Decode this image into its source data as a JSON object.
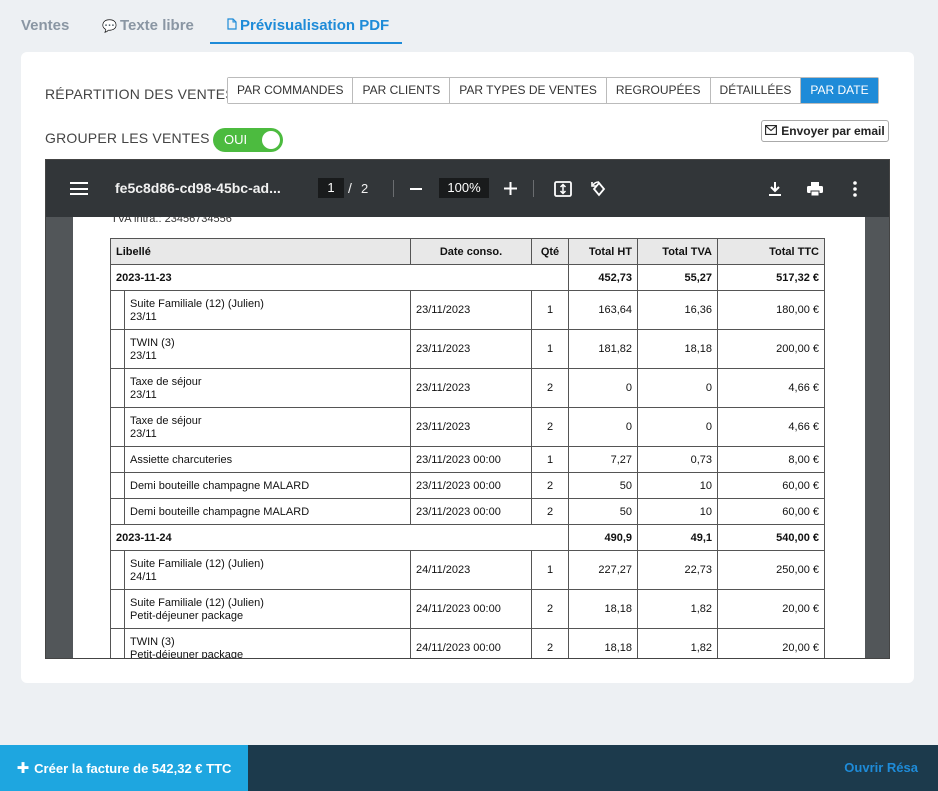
{
  "tabs": [
    {
      "label": "Ventes"
    },
    {
      "label": "Texte libre"
    },
    {
      "label": "Prévisualisation PDF"
    }
  ],
  "repartition": {
    "label": "RÉPARTITION DES VENTES",
    "options": [
      "PAR COMMANDES",
      "PAR CLIENTS",
      "PAR TYPES DE VENTES",
      "REGROUPÉES",
      "DÉTAILLÉES",
      "PAR DATE"
    ],
    "selected": "PAR DATE"
  },
  "grouper": {
    "label": "GROUPER LES VENTES",
    "toggle_label": "OUI",
    "value": true
  },
  "email_button": {
    "label": "Envoyer par email"
  },
  "viewer": {
    "filename": "fe5c8d86-cd98-45bc-ad...",
    "page_current": "1",
    "page_separator": "/",
    "page_total": "2",
    "zoom": "100%",
    "page_top_text": "TVA intra.: 23456734556"
  },
  "table": {
    "headers": [
      "Libellé",
      "Date conso.",
      "Qté",
      "Total HT",
      "Total TVA",
      "Total TTC"
    ],
    "groups": [
      {
        "date": "2023-11-23",
        "total_ht": "452,73",
        "total_tva": "55,27",
        "total_ttc": "517,32 €",
        "items": [
          {
            "label": "Suite Familiale (12) (Julien)",
            "sub": "23/11",
            "date": "23/11/2023",
            "qty": "1",
            "ht": "163,64",
            "tva": "16,36",
            "ttc": "180,00 €"
          },
          {
            "label": "TWIN (3)",
            "sub": "23/11",
            "date": "23/11/2023",
            "qty": "1",
            "ht": "181,82",
            "tva": "18,18",
            "ttc": "200,00 €"
          },
          {
            "label": "Taxe de séjour",
            "sub": "23/11",
            "date": "23/11/2023",
            "qty": "2",
            "ht": "0",
            "tva": "0",
            "ttc": "4,66 €"
          },
          {
            "label": "Taxe de séjour",
            "sub": "23/11",
            "date": "23/11/2023",
            "qty": "2",
            "ht": "0",
            "tva": "0",
            "ttc": "4,66 €"
          },
          {
            "label": "Assiette charcuteries",
            "sub": "",
            "date": "23/11/2023 00:00",
            "qty": "1",
            "ht": "7,27",
            "tva": "0,73",
            "ttc": "8,00 €"
          },
          {
            "label": "Demi bouteille champagne MALARD",
            "sub": "",
            "date": "23/11/2023 00:00",
            "qty": "2",
            "ht": "50",
            "tva": "10",
            "ttc": "60,00 €"
          },
          {
            "label": "Demi bouteille champagne MALARD",
            "sub": "",
            "date": "23/11/2023 00:00",
            "qty": "2",
            "ht": "50",
            "tva": "10",
            "ttc": "60,00 €"
          }
        ]
      },
      {
        "date": "2023-11-24",
        "total_ht": "490,9",
        "total_tva": "49,1",
        "total_ttc": "540,00 €",
        "items": [
          {
            "label": "Suite Familiale (12) (Julien)",
            "sub": "24/11",
            "date": "24/11/2023",
            "qty": "1",
            "ht": "227,27",
            "tva": "22,73",
            "ttc": "250,00 €"
          },
          {
            "label": "Suite Familiale (12) (Julien)",
            "sub": "Petit-déjeuner package",
            "date": "24/11/2023 00:00",
            "qty": "2",
            "ht": "18,18",
            "tva": "1,82",
            "ttc": "20,00 €"
          },
          {
            "label": "TWIN (3)",
            "sub": "Petit-déjeuner package",
            "date": "24/11/2023 00:00",
            "qty": "2",
            "ht": "18,18",
            "tva": "1,82",
            "ttc": "20,00 €"
          }
        ]
      }
    ]
  },
  "footer": {
    "create_label": "Créer la facture de 542,32 € TTC",
    "open_resa_label": "Ouvrir Résa"
  },
  "colors": {
    "accent": "#1e8bd8",
    "toggle_on": "#4cbb3f",
    "footer_bg": "#1c3a4c",
    "create_btn": "#1ea6e0"
  }
}
